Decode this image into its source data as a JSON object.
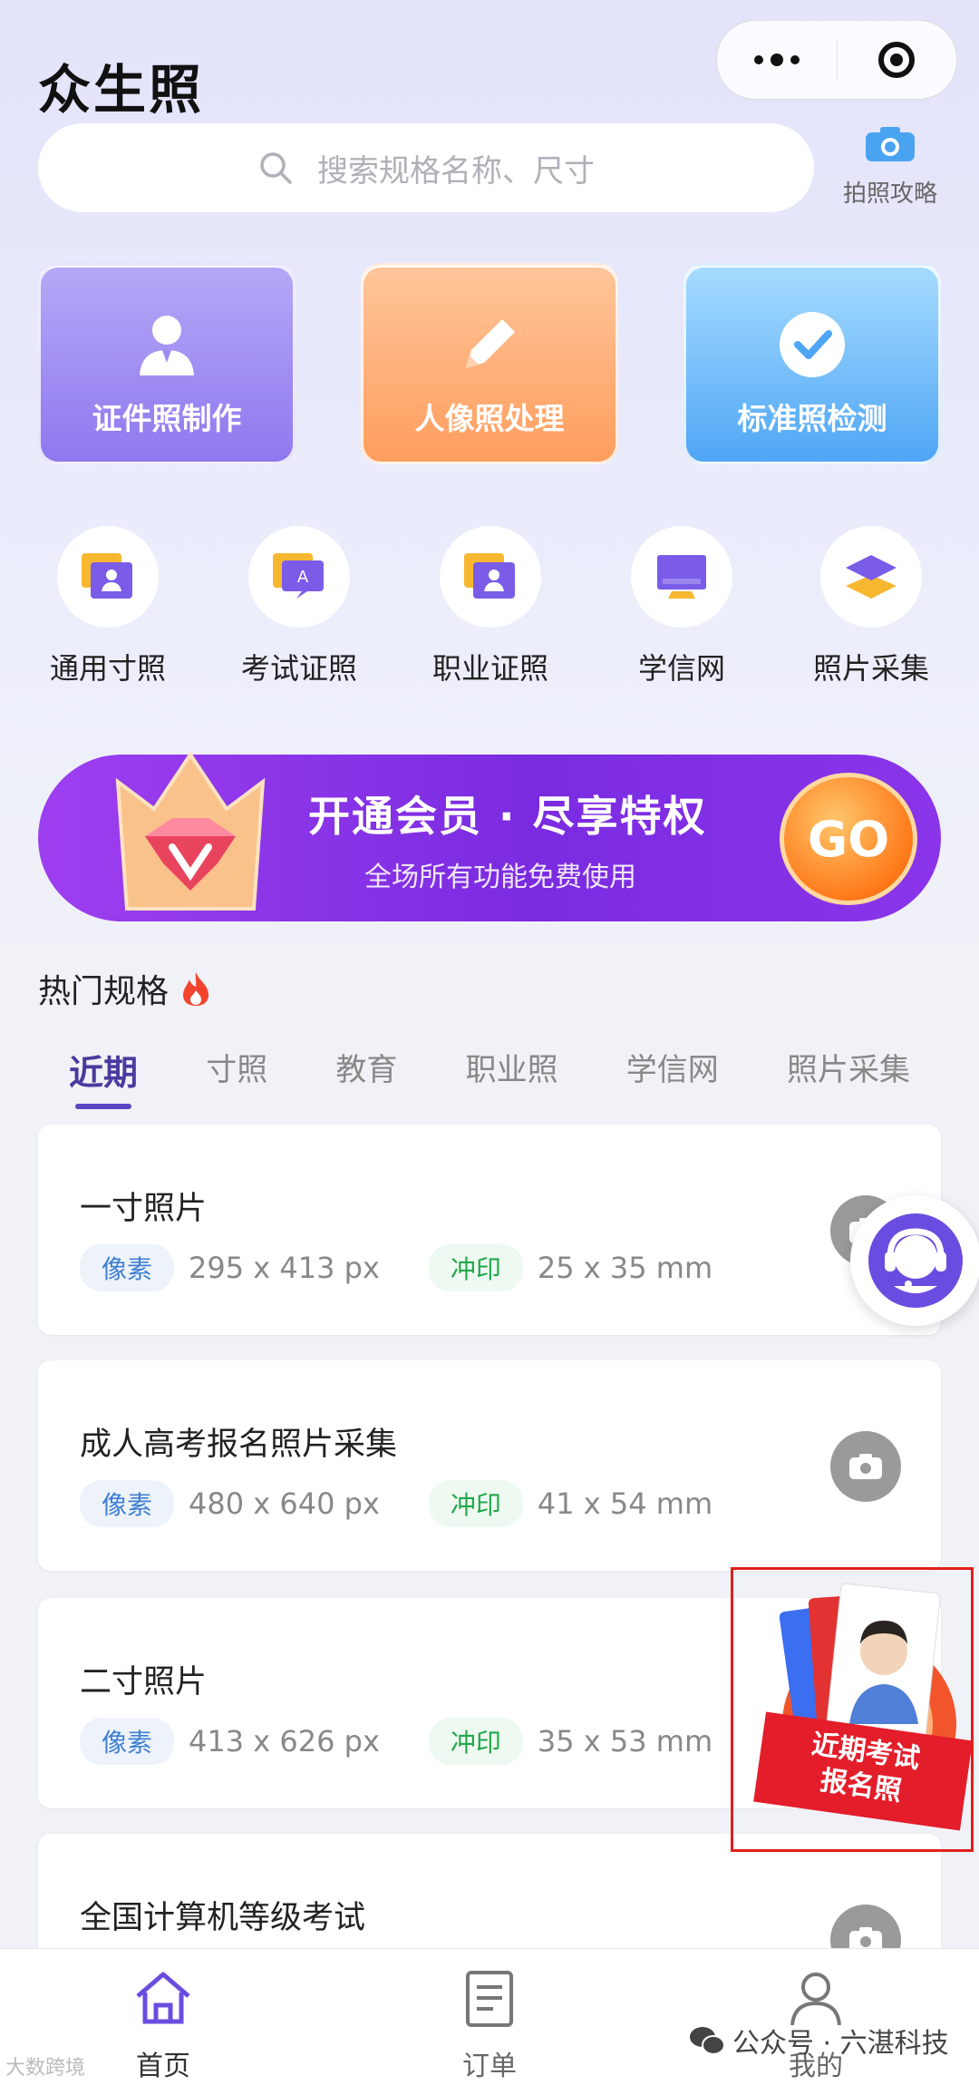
{
  "header": {
    "app_title": "众生照"
  },
  "search": {
    "placeholder": "搜索规格名称、尺寸"
  },
  "guide": {
    "label": "拍照攻略"
  },
  "tiles": [
    {
      "label": "证件照制作"
    },
    {
      "label": "人像照处理"
    },
    {
      "label": "标准照检测"
    }
  ],
  "categories": [
    {
      "label": "通用寸照"
    },
    {
      "label": "考试证照"
    },
    {
      "label": "职业证照"
    },
    {
      "label": "学信网"
    },
    {
      "label": "照片采集"
    }
  ],
  "banner": {
    "title": "开通会员 · 尽享特权",
    "subtitle": "全场所有功能免费使用",
    "go": "GO"
  },
  "hot": {
    "title": "热门规格",
    "tabs": [
      "近期",
      "寸照",
      "教育",
      "职业照",
      "学信网",
      "照片采集"
    ],
    "active_tab": "近期"
  },
  "items": [
    {
      "name": "一寸照片",
      "pixel_label": "像素",
      "pixel": "295 x 413 px",
      "print_label": "冲印",
      "print": "25 x 35 mm"
    },
    {
      "name": "成人高考报名照片采集",
      "pixel_label": "像素",
      "pixel": "480 x 640 px",
      "print_label": "冲印",
      "print": "41 x 54 mm"
    },
    {
      "name": "二寸照片",
      "pixel_label": "像素",
      "pixel": "413 x 626 px",
      "print_label": "冲印",
      "print": "35 x 53 mm"
    },
    {
      "name": "全国计算机等级考试"
    }
  ],
  "promo": {
    "line1": "近期考试",
    "line2": "报名照"
  },
  "nav": [
    {
      "label": "首页"
    },
    {
      "label": "订单"
    },
    {
      "label": "我的"
    }
  ],
  "watermark": {
    "text": "公众号 · 六湛科技",
    "corner": "大数跨境"
  },
  "colors": {
    "accent": "#5b46c4",
    "tile1": "#8f78ef",
    "tile2": "#ff9e5e",
    "tile3": "#4fa6f5",
    "banner": "#7a2be0"
  }
}
